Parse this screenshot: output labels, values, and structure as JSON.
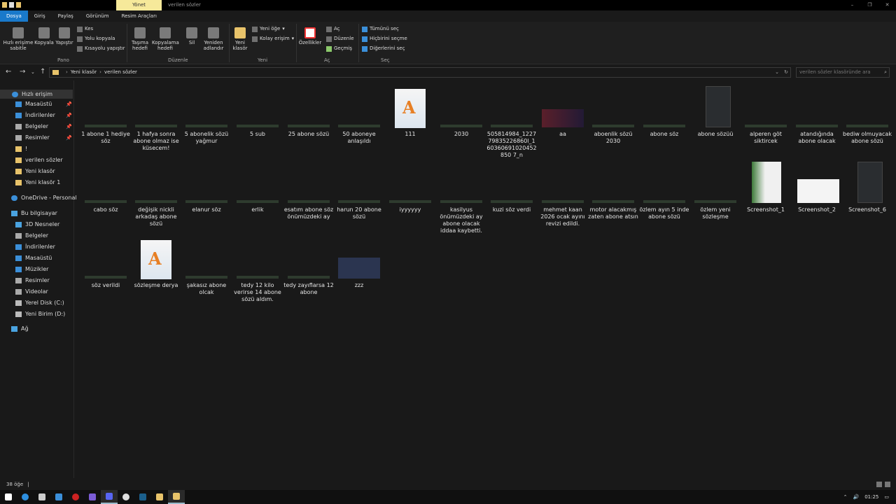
{
  "title": {
    "manage_tab": "Yönet",
    "window_title": "verilen sözler"
  },
  "tabs": [
    "Dosya",
    "Giriş",
    "Paylaş",
    "Görünüm",
    "Resim Araçları"
  ],
  "ribbon": {
    "pin": "Hızlı erişime sabitle",
    "copy": "Kopyala",
    "paste": "Yapıştır",
    "cut": "Kes",
    "copy_path": "Yolu kopyala",
    "paste_shortcut": "Kısayolu yapıştır",
    "move_to": "Taşıma hedefi",
    "copy_to": "Kopyalama hedefi",
    "delete": "Sil",
    "rename": "Yeniden adlandır",
    "new_folder": "Yeni klasör",
    "new_item": "Yeni öğe",
    "easy_access": "Kolay erişim",
    "properties": "Özellikler",
    "open": "Aç",
    "edit": "Düzenle",
    "history": "Geçmiş",
    "select_all": "Tümünü seç",
    "select_none": "Hiçbirini seçme",
    "invert": "Diğerlerini seç",
    "groups": {
      "clipboard": "Pano",
      "organize": "Düzenle",
      "new": "Yeni",
      "open": "Aç",
      "select": "Seç"
    }
  },
  "address": {
    "parent": "Yeni klasör",
    "current": "verilen sözler",
    "search_placeholder": "verilen sözler klasöründe ara"
  },
  "sidebar": {
    "quick": "Hızlı erişim",
    "quick_items": [
      "Masaüstü",
      "İndirilenler",
      "Belgeler",
      "Resimler",
      "!",
      "verilen sözler",
      "Yeni klasör",
      "Yeni klasör 1"
    ],
    "onedrive": "OneDrive - Personal",
    "pc": "Bu bilgisayar",
    "pc_items": [
      "3D Nesneler",
      "Belgeler",
      "İndirilenler",
      "Masaüstü",
      "Müzikler",
      "Resimler",
      "Videolar",
      "Yerel Disk (C:)",
      "Yeni Birim (D:)"
    ],
    "network": "Ağ"
  },
  "files": [
    {
      "name": "1 abone 1 hediye söz",
      "kind": "strip"
    },
    {
      "name": "1 hafya sonra abone olmaz ise küsecem!",
      "kind": "strip"
    },
    {
      "name": "5 abonelik sözü yağmur",
      "kind": "strip"
    },
    {
      "name": "5 sub",
      "kind": "strip"
    },
    {
      "name": "25 abone sözü",
      "kind": "strip"
    },
    {
      "name": "50 aboneye anlaşıldı",
      "kind": "strip"
    },
    {
      "name": "111",
      "kind": "doc"
    },
    {
      "name": "2030",
      "kind": "strip"
    },
    {
      "name": "505814984_122779835226860l_160360691020452850 7_n",
      "kind": "strip"
    },
    {
      "name": "aa",
      "kind": "image-dark"
    },
    {
      "name": "aboenlik sözü 2030",
      "kind": "strip"
    },
    {
      "name": "abone söz",
      "kind": "strip"
    },
    {
      "name": "abone sözüü",
      "kind": "phone"
    },
    {
      "name": "alperen göt siktircek",
      "kind": "strip"
    },
    {
      "name": "atandığında abone olacak",
      "kind": "strip"
    },
    {
      "name": "bediw olmuyacak abone sözü",
      "kind": "strip"
    },
    {
      "name": "cabo söz",
      "kind": "strip"
    },
    {
      "name": "değişik nickli arkadaş abone sözü",
      "kind": "strip"
    },
    {
      "name": "elanur söz",
      "kind": "strip"
    },
    {
      "name": "erlik",
      "kind": "strip"
    },
    {
      "name": "esatım abone söz önümüzdeki ay",
      "kind": "strip"
    },
    {
      "name": "harun 20 abone sözü",
      "kind": "strip"
    },
    {
      "name": "iyyyyyy",
      "kind": "strip"
    },
    {
      "name": "kasilyus önümüzdeki ay abone olacak iddaa kaybetti.",
      "kind": "strip"
    },
    {
      "name": "kuzi söz verdi",
      "kind": "strip"
    },
    {
      "name": "mehmet kaan 2026 ocak ayını revizi edildi.",
      "kind": "strip"
    },
    {
      "name": "motor alacakmış zaten abone atsın",
      "kind": "strip"
    },
    {
      "name": "özlem ayın 5 inde abone sözü",
      "kind": "strip"
    },
    {
      "name": "özlem yeni sözleşme",
      "kind": "strip"
    },
    {
      "name": "Screenshot_1",
      "kind": "green-doc"
    },
    {
      "name": "Screenshot_2",
      "kind": "white-doc"
    },
    {
      "name": "Screenshot_6",
      "kind": "phone"
    },
    {
      "name": "söz verildi",
      "kind": "strip"
    },
    {
      "name": "sözleşme derya",
      "kind": "doc"
    },
    {
      "name": "şakasız abone olcak",
      "kind": "strip"
    },
    {
      "name": "tedy 12 kilo verirse 14 abone sözü aldım.",
      "kind": "strip"
    },
    {
      "name": "tedy zayıflarsa 12 abone",
      "kind": "strip"
    },
    {
      "name": "zzz",
      "kind": "list-image"
    }
  ],
  "status": {
    "count": "38 öğe"
  },
  "tray": {
    "time": "01:25"
  }
}
